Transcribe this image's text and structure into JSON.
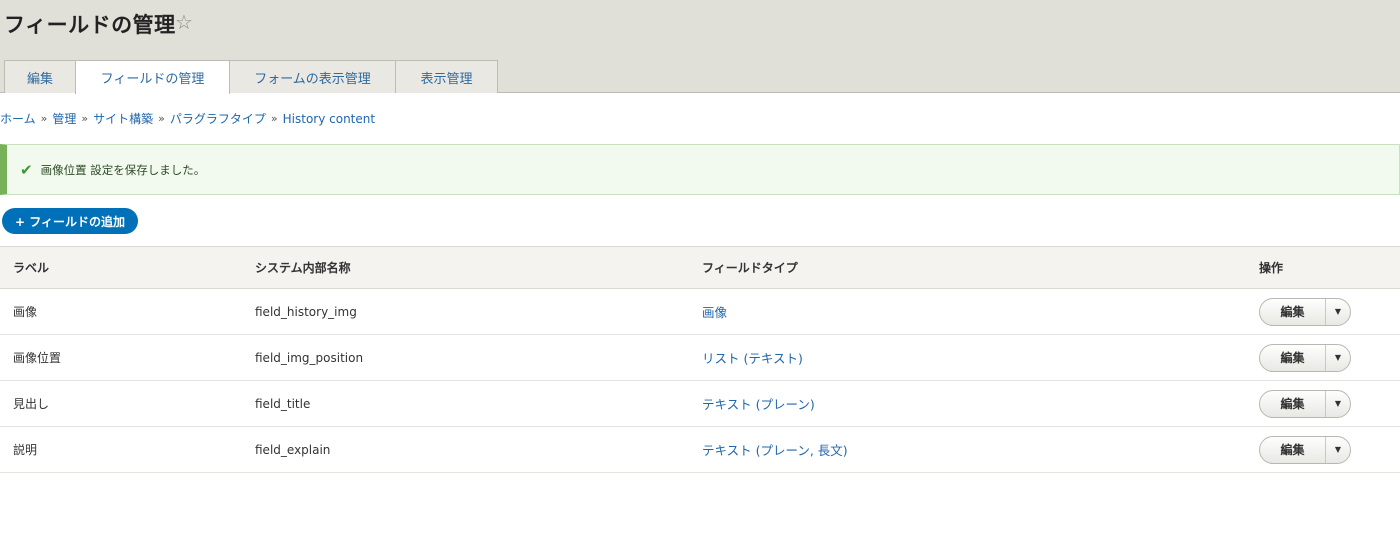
{
  "header": {
    "title": "フィールドの管理",
    "star_icon": "star-outline-icon"
  },
  "tabs": [
    {
      "label": "編集"
    },
    {
      "label": "フィールドの管理",
      "active": true
    },
    {
      "label": "フォームの表示管理"
    },
    {
      "label": "表示管理"
    }
  ],
  "breadcrumb": {
    "items": [
      "ホーム",
      "管理",
      "サイト構築",
      "パラグラフタイプ",
      "History content"
    ],
    "separator": "»"
  },
  "message": {
    "icon": "checkmark-icon",
    "text": "画像位置 設定を保存しました。",
    "color": "#77b259"
  },
  "add_field_button": "+ フィールドの追加",
  "table": {
    "headers": [
      "ラベル",
      "システム内部名称",
      "フィールドタイプ",
      "操作"
    ],
    "rows": [
      {
        "label": "画像",
        "machine_name": "field_history_img",
        "type": "画像",
        "action": "編集"
      },
      {
        "label": "画像位置",
        "machine_name": "field_img_position",
        "type": "リスト (テキスト)",
        "action": "編集"
      },
      {
        "label": "見出し",
        "machine_name": "field_title",
        "type": "テキスト (プレーン)",
        "action": "編集"
      },
      {
        "label": "説明",
        "machine_name": "field_explain",
        "type": "テキスト (プレーン, 長文)",
        "action": "編集"
      }
    ]
  },
  "colors": {
    "link": "#1f66ad",
    "primary_button": "#0071b8",
    "header_bg": "#e0dfd8"
  }
}
